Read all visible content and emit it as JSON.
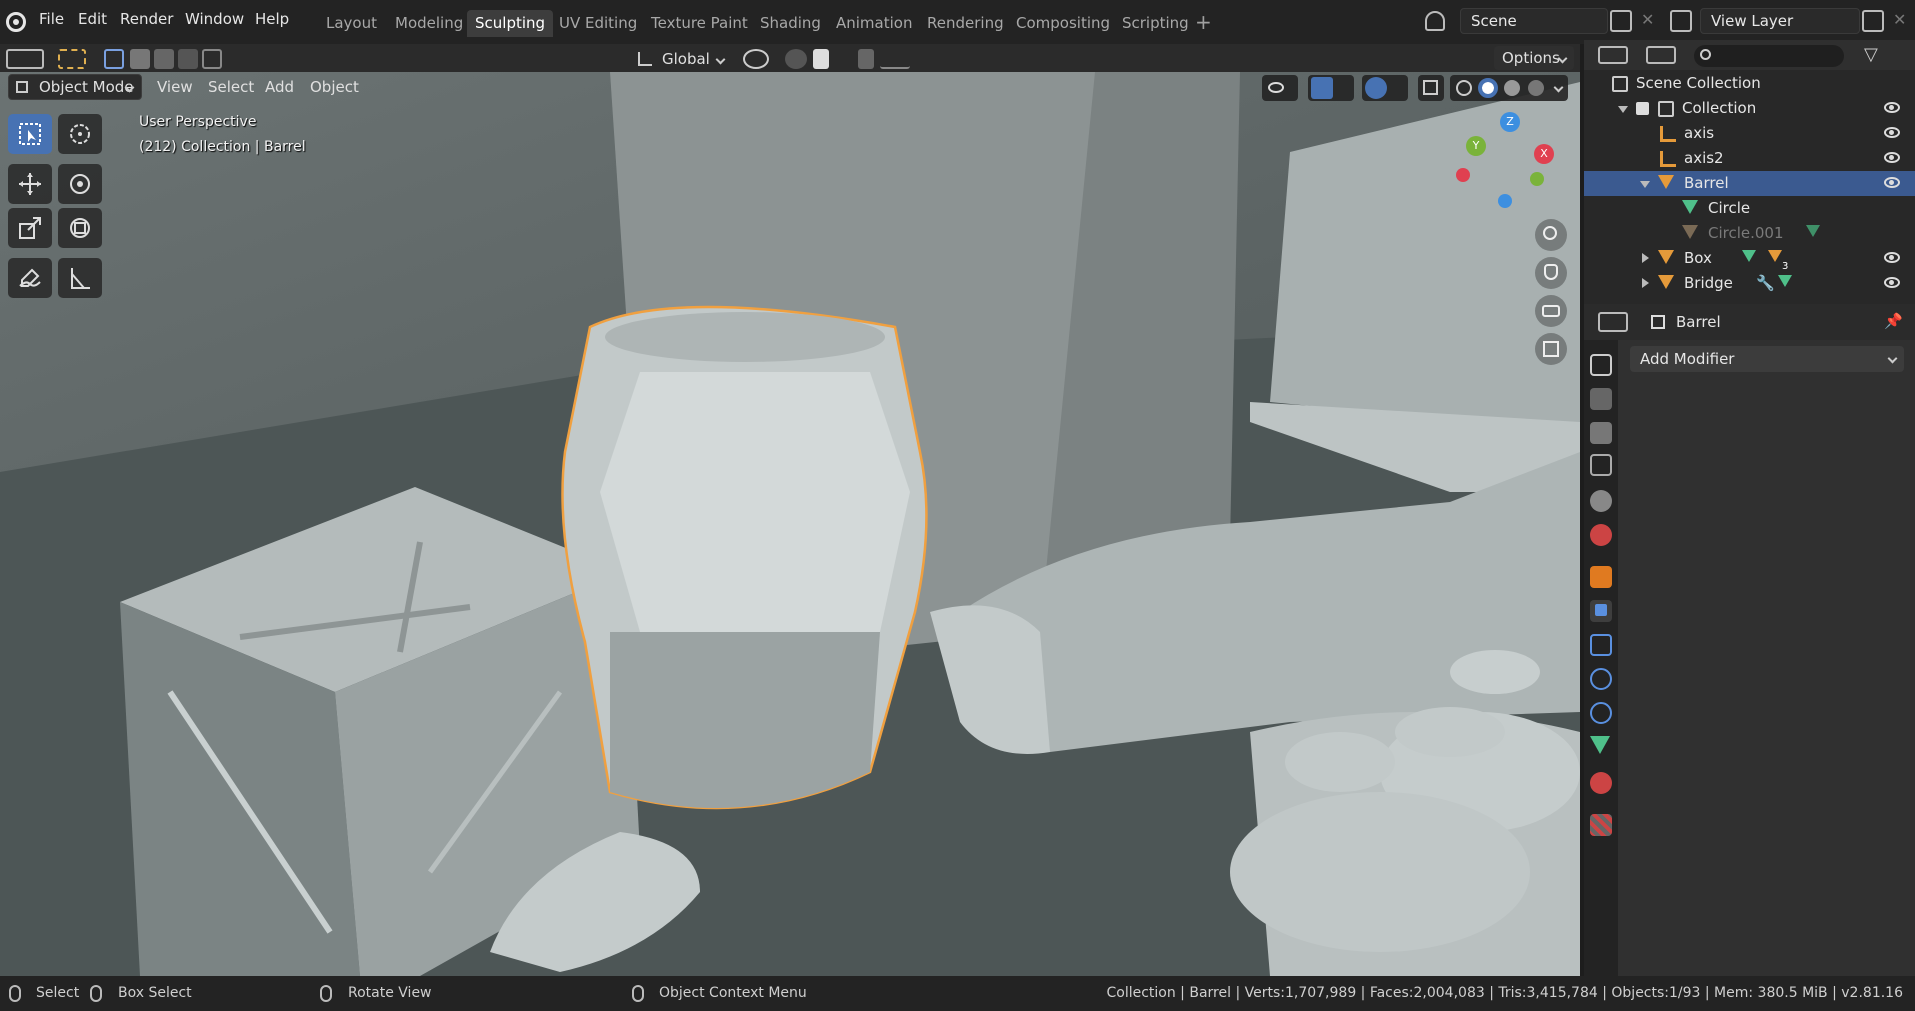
{
  "menus": [
    "File",
    "Edit",
    "Render",
    "Window",
    "Help"
  ],
  "workspaces": [
    "Layout",
    "Modeling",
    "Sculpting",
    "UV Editing",
    "Texture Paint",
    "Shading",
    "Animation",
    "Rendering",
    "Compositing",
    "Scripting"
  ],
  "active_workspace": "Sculpting",
  "scene": "Scene",
  "view_layer": "View Layer",
  "viewport": {
    "transform_orientation": "Global",
    "options_label": "Options",
    "mode": "Object Mode",
    "menu": [
      "View",
      "Select",
      "Add",
      "Object"
    ],
    "perspective": "User Perspective",
    "collection_info": "(212) Collection | Barrel",
    "gizmo": {
      "z": "Z",
      "y": "Y",
      "x": "X"
    }
  },
  "outliner": {
    "root": "Scene Collection",
    "collection": "Collection",
    "items": [
      {
        "name": "axis",
        "type": "empty"
      },
      {
        "name": "axis2",
        "type": "empty"
      },
      {
        "name": "Barrel",
        "type": "mesh",
        "selected": true
      },
      {
        "name": "Circle",
        "type": "mesh-data"
      },
      {
        "name": "Circle.001",
        "type": "mesh-dimmed"
      },
      {
        "name": "Box",
        "type": "mesh"
      },
      {
        "name": "Bridge",
        "type": "mesh"
      }
    ],
    "box_badge": "3"
  },
  "properties": {
    "object_name": "Barrel",
    "add_modifier": "Add Modifier"
  },
  "status": {
    "select": "Select",
    "box_select": "Box Select",
    "rotate": "Rotate View",
    "context": "Object Context Menu",
    "info": "Collection | Barrel | Verts:1,707,989 | Faces:2,004,083 | Tris:3,415,784 | Objects:1/93 | Mem: 380.5 MiB | v2.81.16"
  },
  "colors": {
    "accent": "#4772b3",
    "selection_outline": "#f0a040",
    "outliner_selected": "#3b5a90"
  }
}
